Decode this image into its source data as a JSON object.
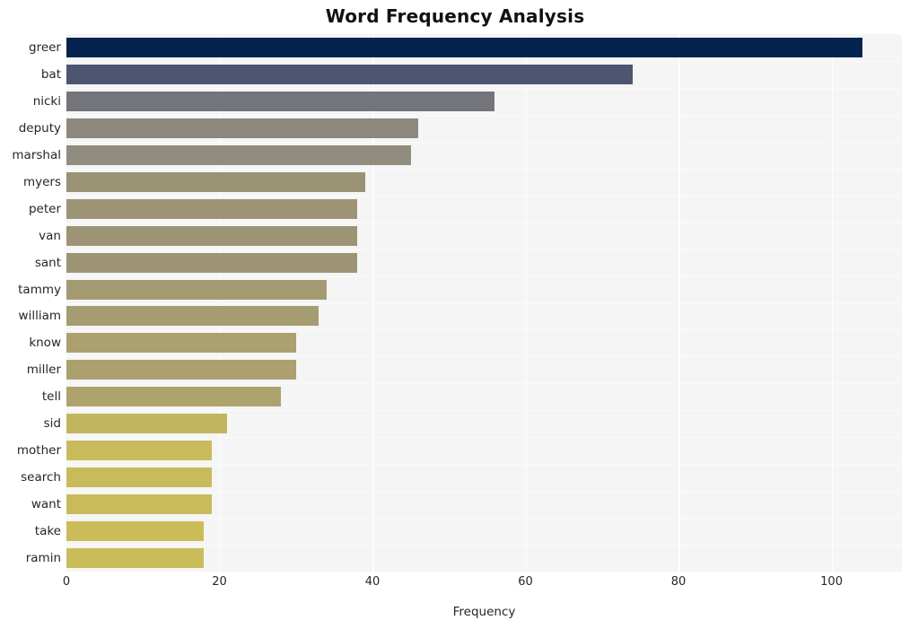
{
  "chart_data": {
    "type": "bar",
    "orientation": "horizontal",
    "title": "Word Frequency Analysis",
    "xlabel": "Frequency",
    "ylabel": "",
    "xlim": [
      0,
      109.2
    ],
    "xticks": [
      0,
      20,
      40,
      60,
      80,
      100
    ],
    "xticklabels": [
      "0",
      "20",
      "40",
      "60",
      "80",
      "100"
    ],
    "grid": true,
    "grid_axis": "x",
    "legend": false,
    "categories": [
      "greer",
      "bat",
      "nicki",
      "deputy",
      "marshal",
      "myers",
      "peter",
      "van",
      "sant",
      "tammy",
      "william",
      "know",
      "miller",
      "tell",
      "sid",
      "mother",
      "search",
      "want",
      "take",
      "ramin"
    ],
    "values": [
      104,
      74,
      56,
      46,
      45,
      39,
      38,
      38,
      38,
      34,
      33,
      30,
      30,
      28,
      21,
      19,
      19,
      19,
      18,
      18
    ],
    "bar_colors": [
      "#04244f",
      "#4e5571",
      "#74757a",
      "#8c897c",
      "#918d7e",
      "#9a9274",
      "#9c9474",
      "#9c9474",
      "#9c9474",
      "#a49a72",
      "#a69c71",
      "#aba06e",
      "#aba06e",
      "#aea26d",
      "#c3b55f",
      "#c9bb5b",
      "#c9bb5b",
      "#c9bb5b",
      "#cbbc5a",
      "#cbbc5a"
    ],
    "plot_bg": "#f5f5f6",
    "grid_color": "#ffffff",
    "title_color": "#111111",
    "tick_color": "#262626"
  },
  "axes": {
    "x_title": "Frequency",
    "tick_labels": [
      "0",
      "20",
      "40",
      "60",
      "80",
      "100"
    ]
  },
  "title": "Word Frequency Analysis"
}
